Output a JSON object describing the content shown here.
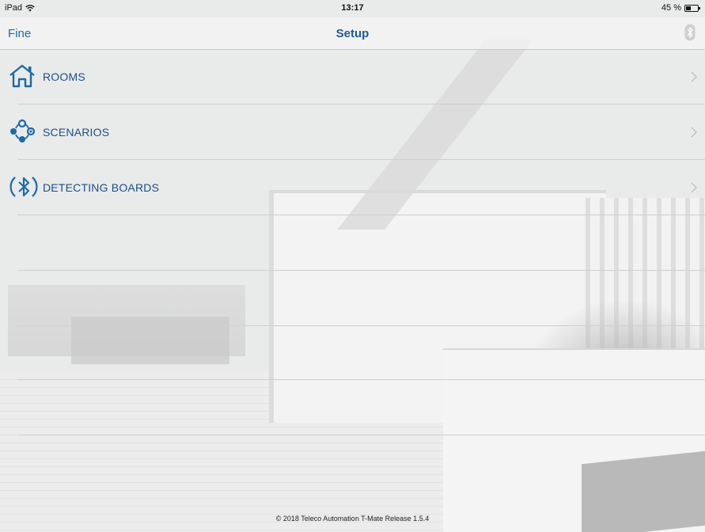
{
  "status_bar": {
    "carrier": "iPad",
    "time": "13:17",
    "battery_percent": "45 %",
    "battery_level": 0.45
  },
  "nav": {
    "back_label": "Fine",
    "title": "Setup",
    "right_icon": "bluetooth-icon"
  },
  "menu": {
    "items": [
      {
        "label": "ROOMS",
        "icon": "house-icon"
      },
      {
        "label": "SCENARIOS",
        "icon": "scenarios-icon"
      },
      {
        "label": "DETECTING BOARDS",
        "icon": "bluetooth-search-icon"
      }
    ]
  },
  "footer": {
    "text": "© 2018 Teleco Automation T-Mate Release 1.5.4"
  },
  "colors": {
    "accent": "#1c6aa6",
    "label": "#1b4f86"
  }
}
